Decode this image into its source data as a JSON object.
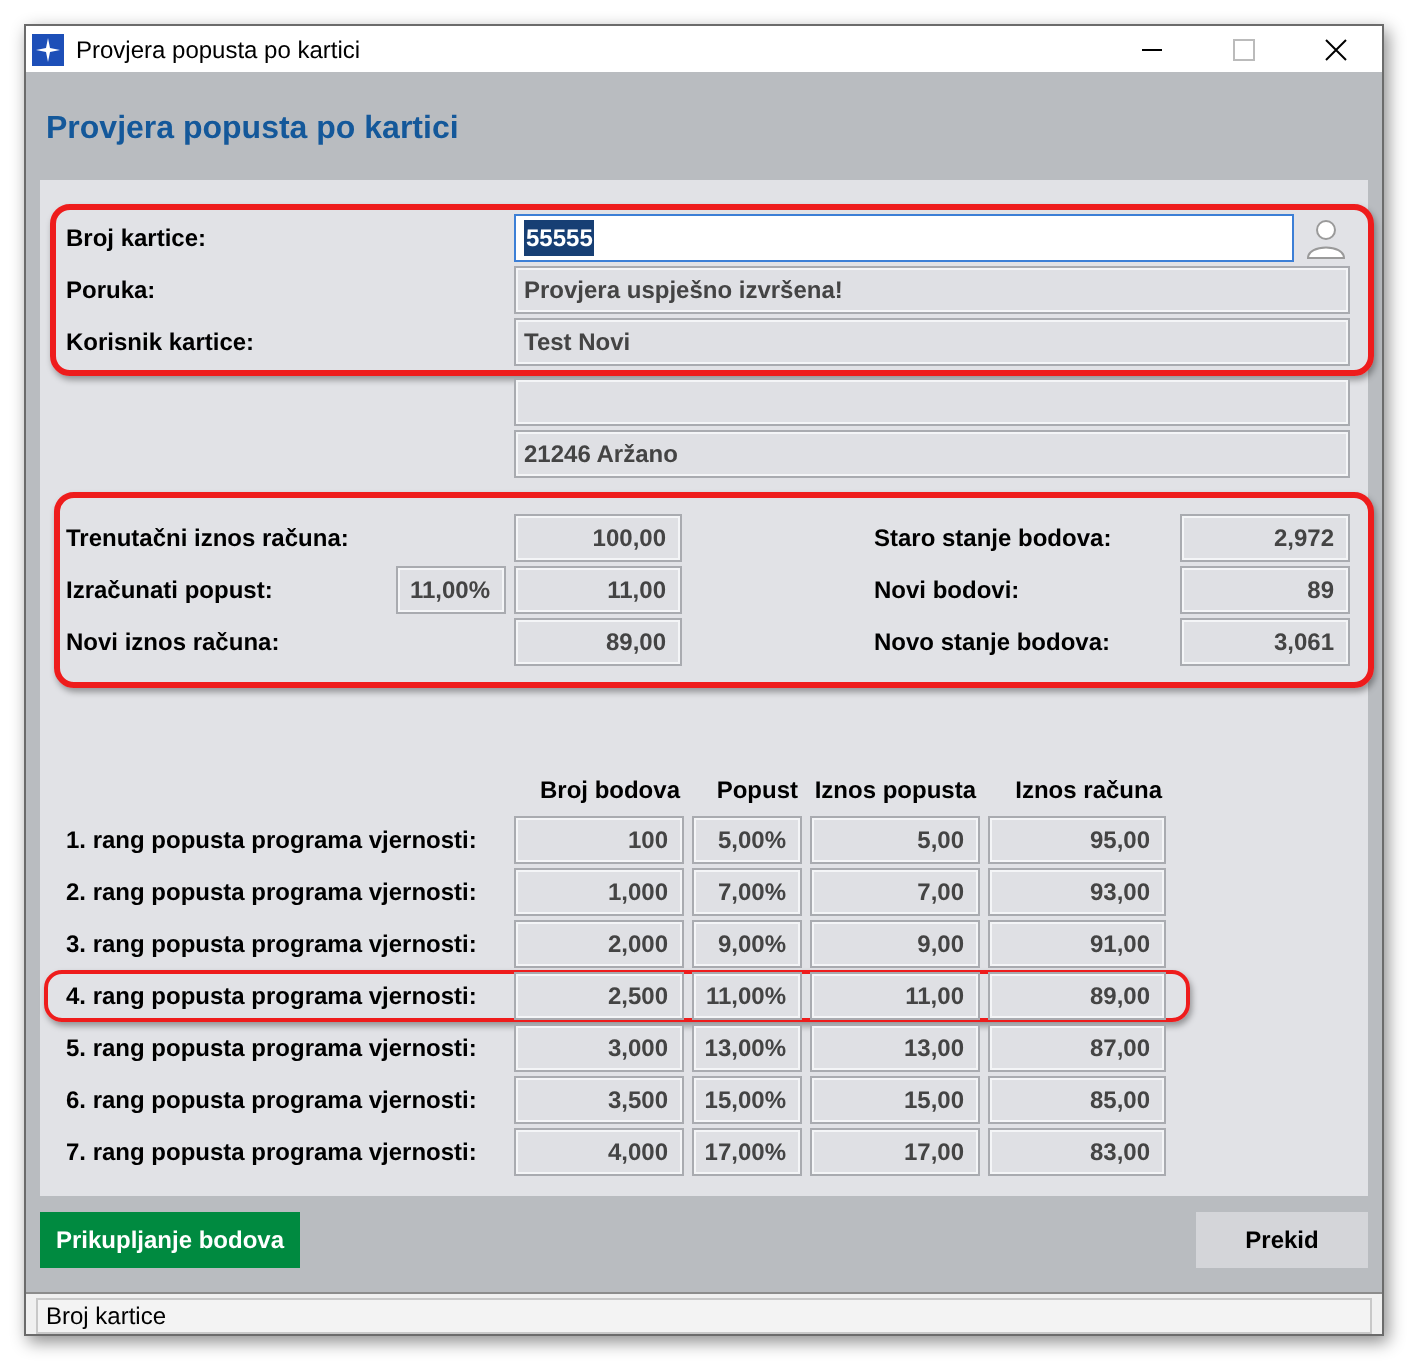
{
  "window": {
    "title": "Provjera popusta po kartici"
  },
  "heading": "Provjera popusta po kartici",
  "card_section": {
    "highlighted": true,
    "fields": [
      {
        "label": "Broj kartice:",
        "value": "55555",
        "kind": "input"
      },
      {
        "label": "Poruka:",
        "value": "Provjera uspješno izvršena!",
        "kind": "readonly"
      },
      {
        "label": "Korisnik kartice:",
        "value": "Test Novi",
        "kind": "readonly"
      }
    ]
  },
  "address": {
    "line_2": "21246 Aržano"
  },
  "totals_section": {
    "highlighted": true,
    "left": [
      {
        "label": "Trenutačni iznos računa:",
        "value": "100,00"
      },
      {
        "label": "Izračunati popust:",
        "percent": "11,00%",
        "value": "11,00"
      },
      {
        "label": "Novi iznos računa:",
        "value": "89,00"
      }
    ],
    "right": [
      {
        "label": "Staro stanje bodova:",
        "value": "2,972"
      },
      {
        "label": "Novi bodovi:",
        "value": "89"
      },
      {
        "label": "Novo stanje bodova:",
        "value": "3,061"
      }
    ]
  },
  "tiers": {
    "columns": [
      "Broj bodova",
      "Popust",
      "Iznos popusta",
      "Iznos računa"
    ],
    "rows": [
      {
        "label": "1. rang popusta programa vjernosti:",
        "values": [
          "100",
          "5,00%",
          "5,00",
          "95,00"
        ],
        "highlighted": false
      },
      {
        "label": "2. rang popusta programa vjernosti:",
        "values": [
          "1,000",
          "7,00%",
          "7,00",
          "93,00"
        ],
        "highlighted": false
      },
      {
        "label": "3. rang popusta programa vjernosti:",
        "values": [
          "2,000",
          "9,00%",
          "9,00",
          "91,00"
        ],
        "highlighted": false
      },
      {
        "label": "4. rang popusta programa vjernosti:",
        "values": [
          "2,500",
          "11,00%",
          "11,00",
          "89,00"
        ],
        "highlighted": true
      },
      {
        "label": "5. rang popusta programa vjernosti:",
        "values": [
          "3,000",
          "13,00%",
          "13,00",
          "87,00"
        ],
        "highlighted": false
      },
      {
        "label": "6. rang popusta programa vjernosti:",
        "values": [
          "3,500",
          "15,00%",
          "15,00",
          "85,00"
        ],
        "highlighted": false
      },
      {
        "label": "7. rang popusta programa vjernosti:",
        "values": [
          "4,000",
          "17,00%",
          "17,00",
          "83,00"
        ],
        "highlighted": false
      }
    ]
  },
  "buttons": {
    "primary": "Prikupljanje bodova",
    "cancel": "Prekid"
  },
  "status_bar": "Broj kartice"
}
